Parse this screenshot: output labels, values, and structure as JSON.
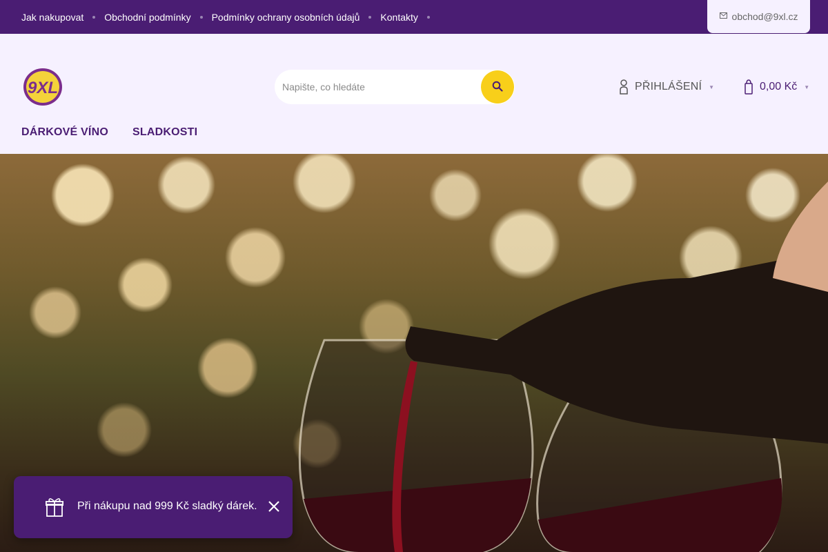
{
  "topbar": {
    "links": [
      "Jak nakupovat",
      "Obchodní podmínky",
      "Podmínky ochrany osobních údajů",
      "Kontakty"
    ],
    "email": "obchod@9xl.cz"
  },
  "header": {
    "logo_text": "9XL",
    "search": {
      "placeholder": "Napište, co hledáte",
      "value": ""
    },
    "login_label": "PŘIHLÁŠENÍ",
    "cart_total": "0,00 Kč",
    "nav": [
      "DÁRKOVÉ VÍNO",
      "SLADKOSTI"
    ]
  },
  "promo": {
    "text": "Při nákupu nad 999 Kč sladký dárek."
  },
  "colors": {
    "brand_purple": "#4a1d73",
    "header_bg": "#f6f1ff",
    "accent_yellow": "#f8cf1a"
  }
}
